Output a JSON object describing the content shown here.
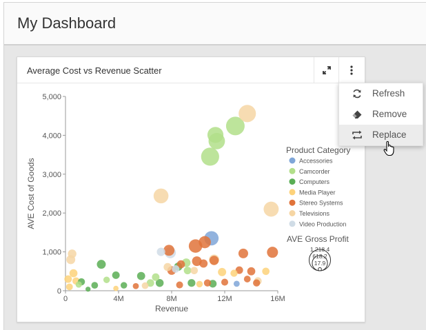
{
  "dashboard": {
    "title": "My Dashboard"
  },
  "card": {
    "title": "Average Cost vs Revenue Scatter"
  },
  "menu": {
    "items": [
      {
        "label": "Refresh",
        "icon": "refresh-icon"
      },
      {
        "label": "Remove",
        "icon": "eraser-icon"
      },
      {
        "label": "Replace",
        "icon": "replace-icon"
      }
    ]
  },
  "colors": {
    "Accessories": "#7fa6d8",
    "Camcorder": "#b2df8a",
    "Computers": "#5aae55",
    "Media Player": "#fdd27a",
    "Stereo Systems": "#e0733a",
    "Televisions": "#f6d6a4",
    "Video Production": "#d0dce6"
  },
  "chart_data": {
    "type": "scatter",
    "xlabel": "Revenue",
    "ylabel": "AVE Cost of Goods",
    "xlim": [
      0,
      16000000
    ],
    "ylim": [
      0,
      5000
    ],
    "xticks": [
      "0",
      "4M",
      "8M",
      "12M",
      "16M"
    ],
    "yticks": [
      "0",
      "1,000",
      "2,000",
      "3,000",
      "4,000",
      "5,000"
    ],
    "legend_title": "Product Category",
    "legend": [
      "Accessories",
      "Camcorder",
      "Computers",
      "Media Player",
      "Stereo Systems",
      "Televisions",
      "Video Production"
    ],
    "size_legend_title": "AVE Gross Profit",
    "size_legend_values": [
      "1,218.4",
      "618.2",
      "17.9"
    ],
    "points": [
      {
        "x": 13700000,
        "y": 4560,
        "s": 1050,
        "c": "Televisions"
      },
      {
        "x": 12800000,
        "y": 4240,
        "s": 1218,
        "c": "Camcorder"
      },
      {
        "x": 11300000,
        "y": 4010,
        "s": 900,
        "c": "Camcorder"
      },
      {
        "x": 11400000,
        "y": 3850,
        "s": 950,
        "c": "Camcorder"
      },
      {
        "x": 10900000,
        "y": 3450,
        "s": 1150,
        "c": "Camcorder"
      },
      {
        "x": 7200000,
        "y": 2440,
        "s": 780,
        "c": "Televisions"
      },
      {
        "x": 15500000,
        "y": 2100,
        "s": 800,
        "c": "Televisions"
      },
      {
        "x": 11000000,
        "y": 1350,
        "s": 720,
        "c": "Accessories"
      },
      {
        "x": 9800000,
        "y": 1150,
        "s": 640,
        "c": "Stereo Systems"
      },
      {
        "x": 10500000,
        "y": 1250,
        "s": 520,
        "c": "Stereo Systems"
      },
      {
        "x": 7800000,
        "y": 1040,
        "s": 420,
        "c": "Stereo Systems"
      },
      {
        "x": 7900000,
        "y": 980,
        "s": 440,
        "c": "Video Production"
      },
      {
        "x": 15600000,
        "y": 990,
        "s": 430,
        "c": "Stereo Systems"
      },
      {
        "x": 13400000,
        "y": 960,
        "s": 330,
        "c": "Stereo Systems"
      },
      {
        "x": 11200000,
        "y": 800,
        "s": 370,
        "c": "Televisions"
      },
      {
        "x": 11200000,
        "y": 780,
        "s": 300,
        "c": "Stereo Systems"
      },
      {
        "x": 9900000,
        "y": 760,
        "s": 330,
        "c": "Stereo Systems"
      },
      {
        "x": 9100000,
        "y": 720,
        "s": 260,
        "c": "Camcorder"
      },
      {
        "x": 10400000,
        "y": 700,
        "s": 240,
        "c": "Stereo Systems"
      },
      {
        "x": 8700000,
        "y": 680,
        "s": 230,
        "c": "Stereo Systems"
      },
      {
        "x": 8500000,
        "y": 620,
        "s": 240,
        "c": "Computers"
      },
      {
        "x": 7700000,
        "y": 610,
        "s": 230,
        "c": "Televisions"
      },
      {
        "x": 8300000,
        "y": 560,
        "s": 200,
        "c": "Video Production"
      },
      {
        "x": 8000000,
        "y": 520,
        "s": 260,
        "c": "Stereo Systems"
      },
      {
        "x": 9700000,
        "y": 520,
        "s": 190,
        "c": "Televisions"
      },
      {
        "x": 9200000,
        "y": 520,
        "s": 200,
        "c": "Camcorder"
      },
      {
        "x": 11800000,
        "y": 480,
        "s": 240,
        "c": "Media Player"
      },
      {
        "x": 13100000,
        "y": 530,
        "s": 200,
        "c": "Stereo Systems"
      },
      {
        "x": 14000000,
        "y": 500,
        "s": 230,
        "c": "Stereo Systems"
      },
      {
        "x": 12700000,
        "y": 450,
        "s": 180,
        "c": "Media Player"
      },
      {
        "x": 2700000,
        "y": 680,
        "s": 280,
        "c": "Computers"
      },
      {
        "x": 500000,
        "y": 950,
        "s": 260,
        "c": "Televisions"
      },
      {
        "x": 400000,
        "y": 800,
        "s": 280,
        "c": "Televisions"
      },
      {
        "x": 600000,
        "y": 450,
        "s": 230,
        "c": "Media Player"
      },
      {
        "x": 3800000,
        "y": 400,
        "s": 200,
        "c": "Computers"
      },
      {
        "x": 5700000,
        "y": 380,
        "s": 230,
        "c": "Computers"
      },
      {
        "x": 6800000,
        "y": 350,
        "s": 200,
        "c": "Camcorder"
      },
      {
        "x": 1200000,
        "y": 230,
        "s": 180,
        "c": "Computers"
      },
      {
        "x": 3100000,
        "y": 280,
        "s": 150,
        "c": "Camcorder"
      },
      {
        "x": 6400000,
        "y": 200,
        "s": 200,
        "c": "Camcorder"
      },
      {
        "x": 7100000,
        "y": 200,
        "s": 220,
        "c": "Computers"
      },
      {
        "x": 9500000,
        "y": 200,
        "s": 210,
        "c": "Computers"
      },
      {
        "x": 10700000,
        "y": 200,
        "s": 180,
        "c": "Stereo Systems"
      },
      {
        "x": 11100000,
        "y": 180,
        "s": 210,
        "c": "Computers"
      },
      {
        "x": 12000000,
        "y": 220,
        "s": 170,
        "c": "Stereo Systems"
      },
      {
        "x": 14500000,
        "y": 250,
        "s": 200,
        "c": "Televisions"
      },
      {
        "x": 14400000,
        "y": 200,
        "s": 180,
        "c": "Stereo Systems"
      },
      {
        "x": 2200000,
        "y": 140,
        "s": 160,
        "c": "Computers"
      },
      {
        "x": 4400000,
        "y": 140,
        "s": 150,
        "c": "Computers"
      },
      {
        "x": 5300000,
        "y": 120,
        "s": 130,
        "c": "Stereo Systems"
      },
      {
        "x": 800000,
        "y": 250,
        "s": 190,
        "c": "Media Player"
      },
      {
        "x": 1000000,
        "y": 160,
        "s": 140,
        "c": "Camcorder"
      },
      {
        "x": 300000,
        "y": 100,
        "s": 160,
        "c": "Media Player"
      },
      {
        "x": 1700000,
        "y": 40,
        "s": 90,
        "c": "Computers"
      },
      {
        "x": 3800000,
        "y": 60,
        "s": 100,
        "c": "Media Player"
      },
      {
        "x": 8600000,
        "y": 150,
        "s": 170,
        "c": "Stereo Systems"
      },
      {
        "x": 10100000,
        "y": 170,
        "s": 150,
        "c": "Media Player"
      },
      {
        "x": 12900000,
        "y": 180,
        "s": 130,
        "c": "Accessories"
      },
      {
        "x": 13700000,
        "y": 300,
        "s": 160,
        "c": "Stereo Systems"
      },
      {
        "x": 6000000,
        "y": 130,
        "s": 160,
        "c": "Televisions"
      },
      {
        "x": 200000,
        "y": 300,
        "s": 200,
        "c": "Media Player"
      },
      {
        "x": 7200000,
        "y": 1000,
        "s": 250,
        "c": "Video Production"
      },
      {
        "x": 15100000,
        "y": 500,
        "s": 190,
        "c": "Media Player"
      }
    ]
  }
}
